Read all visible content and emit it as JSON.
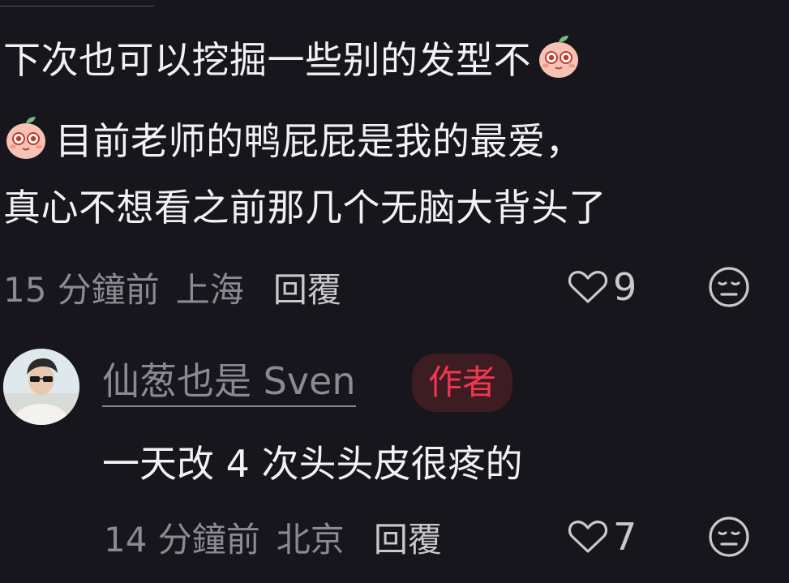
{
  "comment": {
    "line1": "下次也可以挖掘一些别的发型不",
    "line2": "目前老师的鸭屁屁是我的最爱，",
    "line3": "真心不想看之前那几个无脑大背头了",
    "emoji_icon": "peach-face-emoji",
    "time": "15 分鐘前",
    "location": "上海",
    "reply_label": "回覆",
    "like_count": "9"
  },
  "reply": {
    "author_name": "仙葱也是 Sven",
    "author_badge": "作者",
    "text": "一天改 4 次头头皮很疼的",
    "time": "14 分鐘前",
    "location": "北京",
    "reply_label": "回覆",
    "like_count": "7"
  },
  "icons": {
    "like": "heart-outline-icon",
    "dislike": "neutral-face-icon"
  },
  "colors": {
    "background": "#17161c",
    "text_primary": "#f2f1f4",
    "text_secondary": "#8b8a90",
    "author_badge_text": "#f2364f",
    "author_badge_bg": "#3d1c22"
  }
}
